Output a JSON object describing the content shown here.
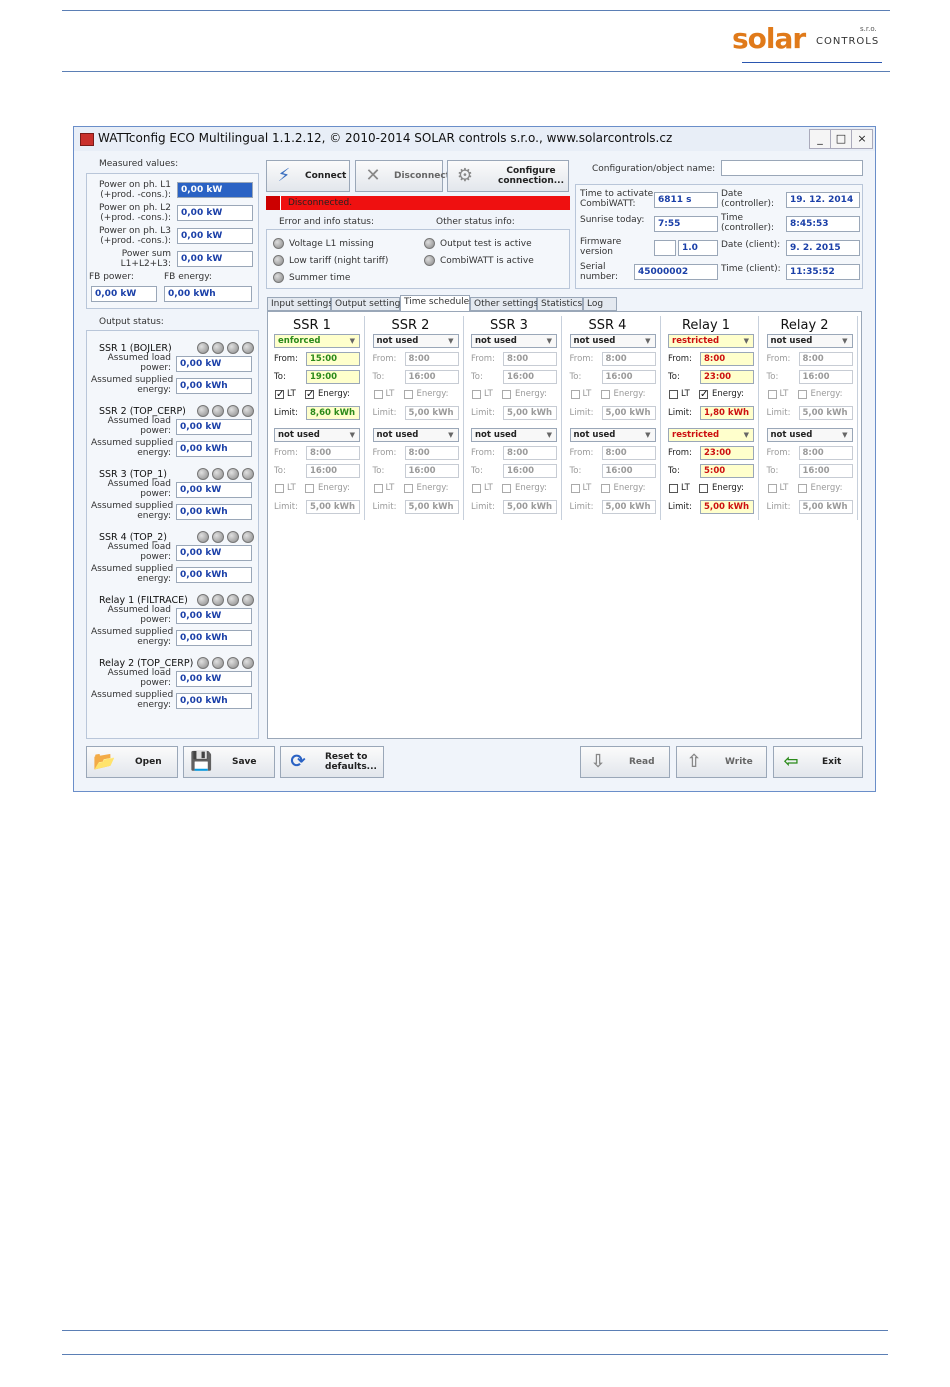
{
  "logo": {
    "brand": "solar",
    "suffix": "CONTROLS",
    "sro": "s.r.o."
  },
  "window": {
    "title": "WATTconfig ECO Multilingual 1.1.2.12, © 2010-2014 SOLAR controls s.r.o., www.solarcontrols.cz",
    "min": "_",
    "max": "□",
    "close": "×"
  },
  "measured": {
    "title": "Measured values:",
    "rows": [
      {
        "label1": "Power on ph. L1",
        "label2": "(+prod. -cons.):",
        "value": "0,00 kW"
      },
      {
        "label1": "Power on ph. L2",
        "label2": "(+prod. -cons.):",
        "value": "0,00 kW"
      },
      {
        "label1": "Power on ph. L3",
        "label2": "(+prod. -cons.):",
        "value": "0,00 kW"
      },
      {
        "label1": "Power sum",
        "label2": "L1+L2+L3:",
        "value": "0,00 kW"
      }
    ],
    "fb_power_label": "FB power:",
    "fb_power": "0,00 kW",
    "fb_energy_label": "FB energy:",
    "fb_energy": "0,00 kWh"
  },
  "output_status": {
    "title": "Output status:",
    "load_label1": "Assumed load",
    "load_label2": "power:",
    "sup_label1": "Assumed supplied",
    "sup_label2": "energy:",
    "outputs": [
      {
        "name": "SSR 1 (BOJLER)",
        "power": "0,00 kW",
        "energy": "0,00 kWh"
      },
      {
        "name": "SSR 2 (TOP_CERP)",
        "power": "0,00 kW",
        "energy": "0,00 kWh"
      },
      {
        "name": "SSR 3 (TOP_1)",
        "power": "0,00 kW",
        "energy": "0,00 kWh"
      },
      {
        "name": "SSR 4 (TOP_2)",
        "power": "0,00 kW",
        "energy": "0,00 kWh"
      },
      {
        "name": "Relay 1 (FILTRACE)",
        "power": "0,00 kW",
        "energy": "0,00 kWh"
      },
      {
        "name": "Relay 2 (TOP_CERP)",
        "power": "0,00 kW",
        "energy": "0,00 kWh"
      }
    ]
  },
  "toolbar": {
    "connect": "Connect",
    "disconnect": "Disconnect",
    "configure1": "Configure",
    "configure2": "connection..."
  },
  "status": {
    "text": "Disconnected.",
    "error_title": "Error and info status:",
    "other_title": "Other status info:",
    "errors": [
      "Voltage L1 missing",
      "Low tariff (night tariff)",
      "Summer time"
    ],
    "others": [
      "Output test is active",
      "CombiWATT is active"
    ]
  },
  "config": {
    "name_label": "Configuration/object name:",
    "name_value": "",
    "time_act_label1": "Time to activate",
    "time_act_label2": "CombiWATT:",
    "time_act": "6811 s",
    "sunrise_label": "Sunrise today:",
    "sunrise": "7:55",
    "fw_label1": "Firmware",
    "fw_label2": "version",
    "fw_major": "",
    "fw": "1.0",
    "serial_label1": "Serial",
    "serial_label2": "number:",
    "serial": "45000002",
    "date_ctrl_label1": "Date",
    "date_ctrl_label2": "(controller):",
    "date_ctrl": "19. 12. 2014",
    "time_ctrl_label1": "Time",
    "time_ctrl_label2": "(controller):",
    "time_ctrl": "8:45:53",
    "date_client_label": "Date (client):",
    "date_client": "9. 2. 2015",
    "time_client_label": "Time (client):",
    "time_client": "11:35:52"
  },
  "tabs": [
    "Input settings",
    "Output settings",
    "Time schedules",
    "Other settings",
    "Statistics",
    "Log"
  ],
  "schedule_labels": {
    "from": "From:",
    "to": "To:",
    "lt": "LT",
    "energy": "Energy:",
    "limit": "Limit:"
  },
  "schedules": [
    {
      "name": "SSR 1",
      "a": {
        "mode": "enforced",
        "from": "15:00",
        "to": "19:00",
        "lt": true,
        "energy": true,
        "limit": "8,60 kWh",
        "active": "green"
      },
      "b": {
        "mode": "not used",
        "from": "8:00",
        "to": "16:00",
        "lt": false,
        "energy": false,
        "limit": "5,00 kWh",
        "active": ""
      }
    },
    {
      "name": "SSR 2",
      "a": {
        "mode": "not used",
        "from": "8:00",
        "to": "16:00",
        "lt": false,
        "energy": false,
        "limit": "5,00 kWh",
        "active": ""
      },
      "b": {
        "mode": "not used",
        "from": "8:00",
        "to": "16:00",
        "lt": false,
        "energy": false,
        "limit": "5,00 kWh",
        "active": ""
      }
    },
    {
      "name": "SSR 3",
      "a": {
        "mode": "not used",
        "from": "8:00",
        "to": "16:00",
        "lt": false,
        "energy": false,
        "limit": "5,00 kWh",
        "active": ""
      },
      "b": {
        "mode": "not used",
        "from": "8:00",
        "to": "16:00",
        "lt": false,
        "energy": false,
        "limit": "5,00 kWh",
        "active": ""
      }
    },
    {
      "name": "SSR 4",
      "a": {
        "mode": "not used",
        "from": "8:00",
        "to": "16:00",
        "lt": false,
        "energy": false,
        "limit": "5,00 kWh",
        "active": ""
      },
      "b": {
        "mode": "not used",
        "from": "8:00",
        "to": "16:00",
        "lt": false,
        "energy": false,
        "limit": "5,00 kWh",
        "active": ""
      }
    },
    {
      "name": "Relay 1",
      "a": {
        "mode": "restricted",
        "from": "8:00",
        "to": "23:00",
        "lt": false,
        "energy": true,
        "limit": "1,80 kWh",
        "active": "red"
      },
      "b": {
        "mode": "restricted",
        "from": "23:00",
        "to": "5:00",
        "lt": false,
        "energy": false,
        "limit": "5,00 kWh",
        "active": "red"
      }
    },
    {
      "name": "Relay 2",
      "a": {
        "mode": "not used",
        "from": "8:00",
        "to": "16:00",
        "lt": false,
        "energy": false,
        "limit": "5,00 kWh",
        "active": ""
      },
      "b": {
        "mode": "not used",
        "from": "8:00",
        "to": "16:00",
        "lt": false,
        "energy": false,
        "limit": "5,00 kWh",
        "active": ""
      }
    }
  ],
  "bottom": {
    "open": "Open",
    "save": "Save",
    "reset1": "Reset to",
    "reset2": "defaults...",
    "read": "Read",
    "write": "Write",
    "exit": "Exit"
  },
  "colors": {
    "accent": "#2a62c4",
    "status_red": "#ef1010",
    "enforced_green": "#2b8a1a",
    "restricted_red": "#cc1010",
    "logo_orange": "#e07a1a"
  }
}
